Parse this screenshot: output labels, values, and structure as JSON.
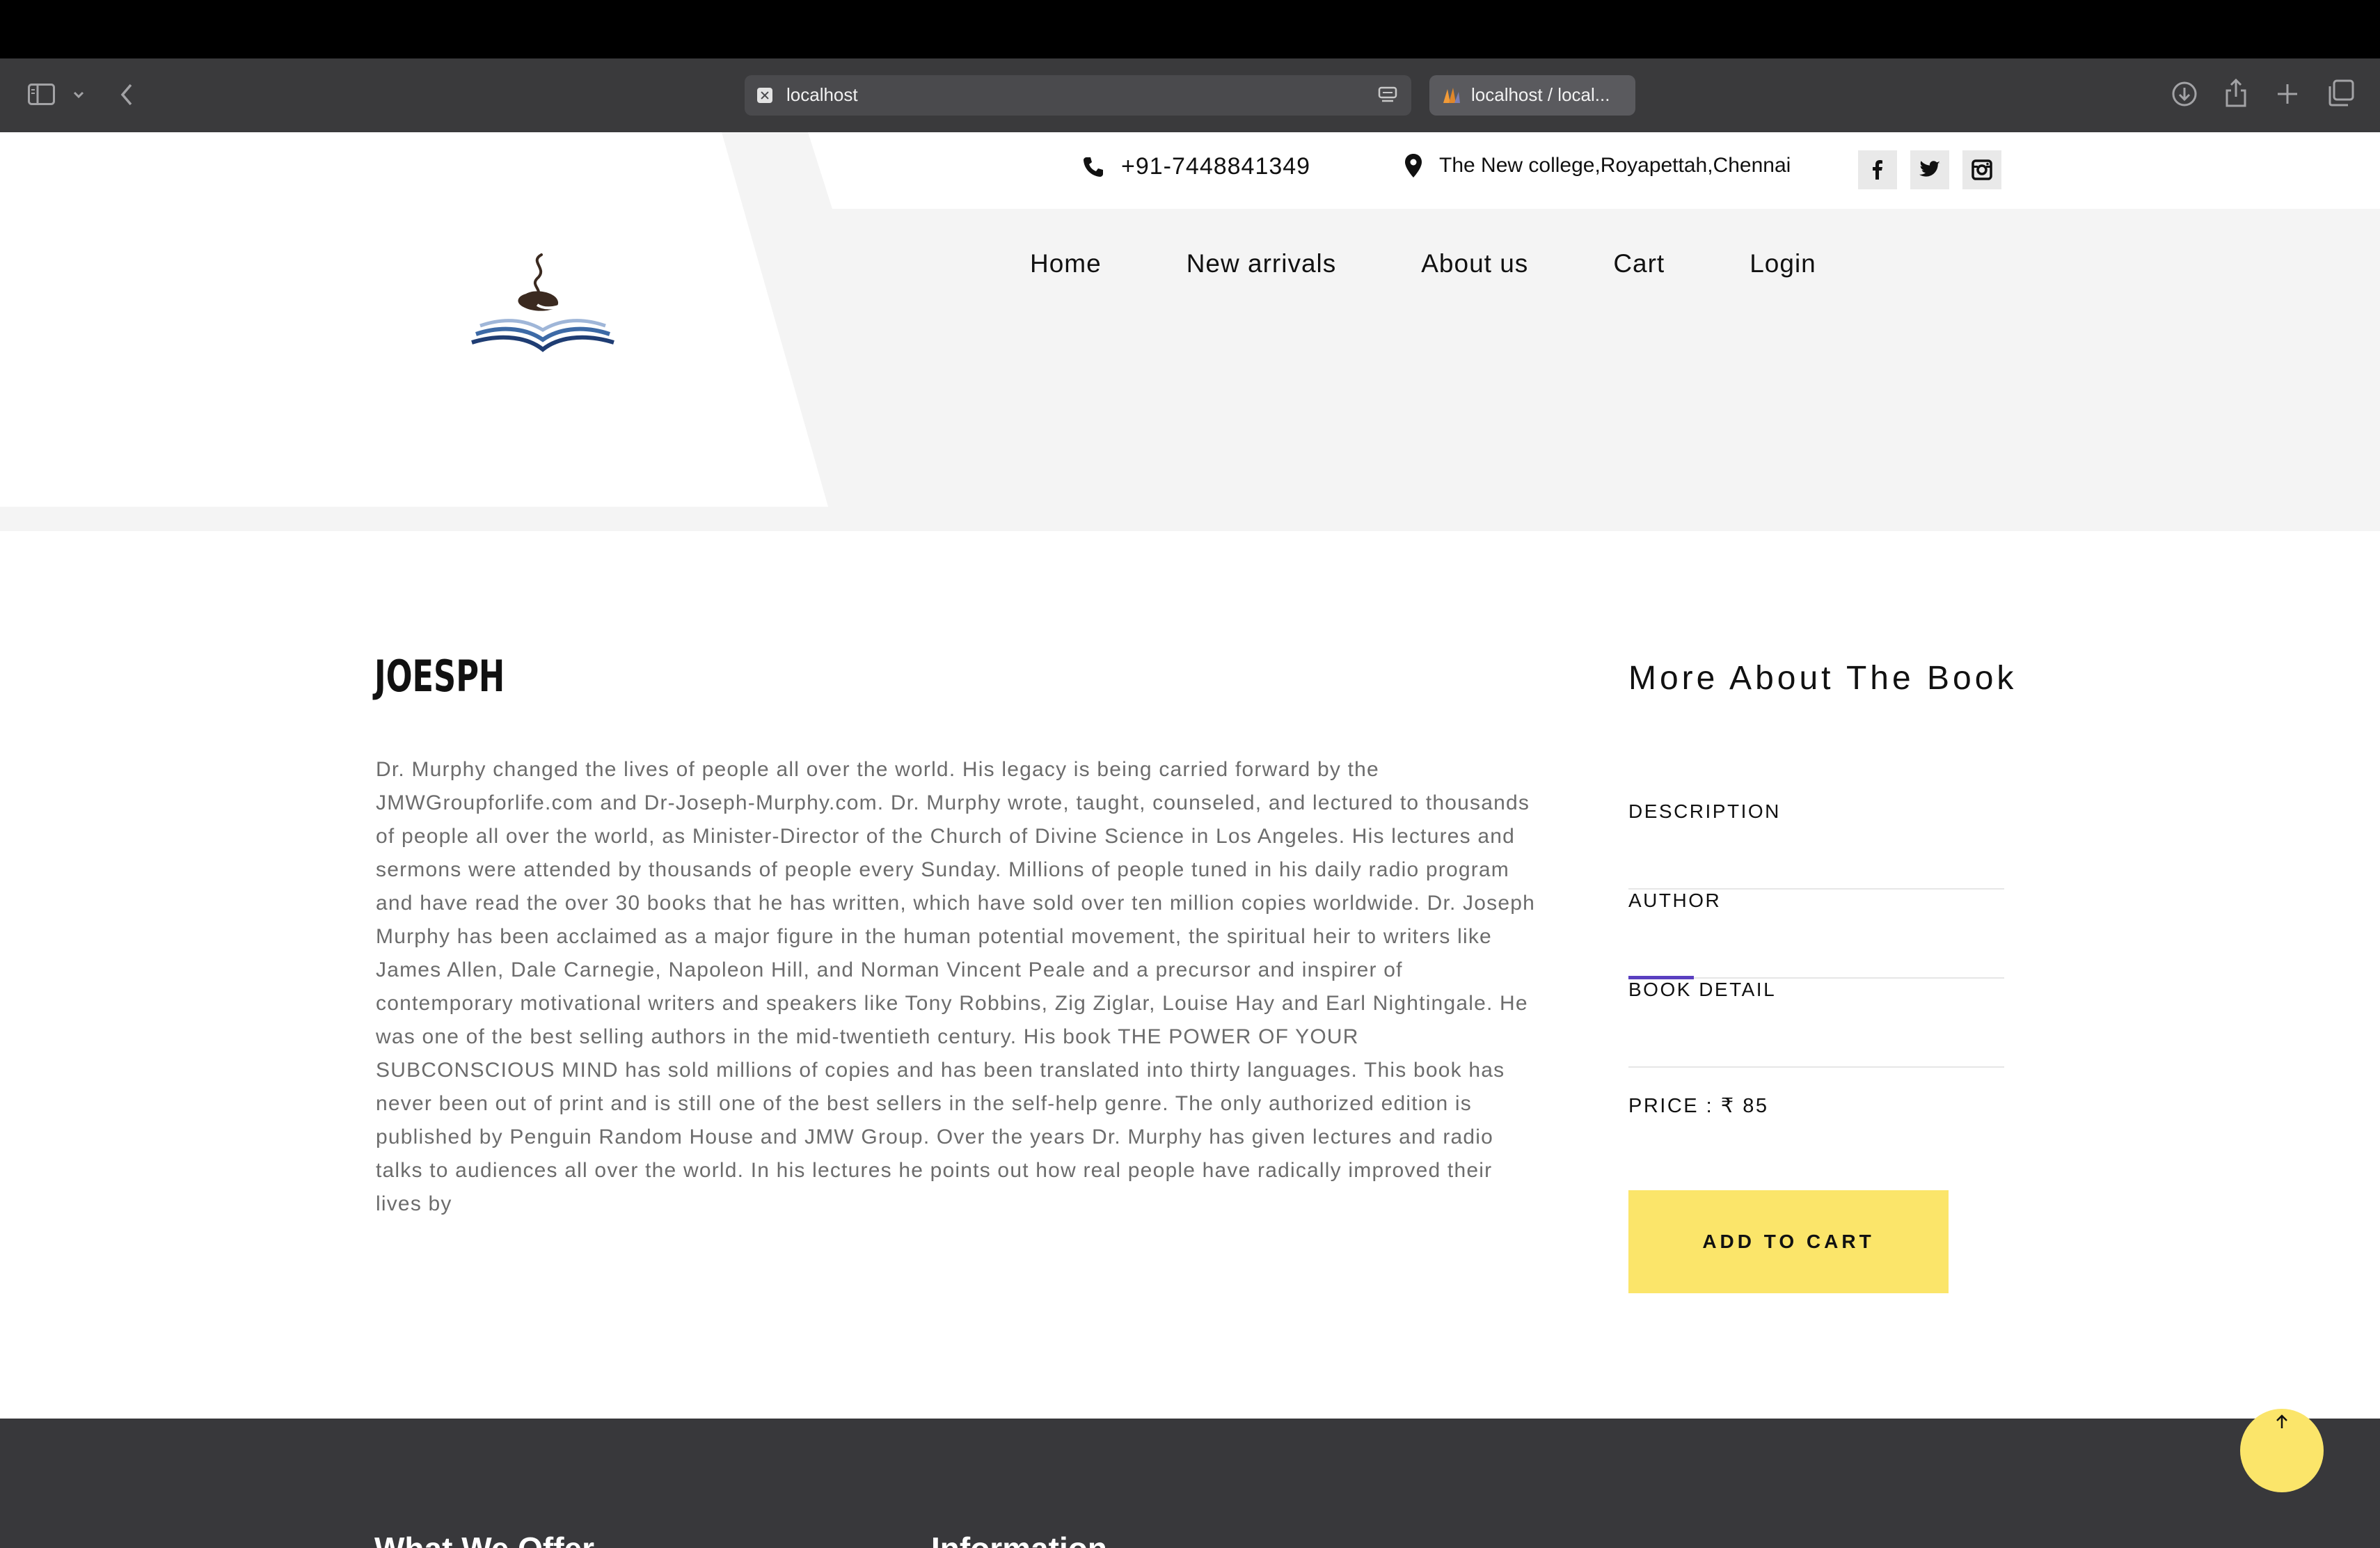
{
  "browser": {
    "url": "localhost",
    "tab_title": "localhost / local..."
  },
  "header": {
    "phone": "+91-7448841349",
    "address": "The New college,Royapettah,Chennai",
    "social": [
      "facebook-icon",
      "twitter-icon",
      "instagram-icon"
    ],
    "nav": [
      "Home",
      "New arrivals",
      "About us",
      "Cart",
      "Login"
    ]
  },
  "book": {
    "title": "JOESPH",
    "description": "Dr. Murphy changed the lives of people all over the world. His legacy is being carried forward by the JMWGroupforlife.com and Dr-Joseph-Murphy.com. Dr. Murphy wrote, taught, counseled, and lectured to thousands of people all over the world, as Minister-Director of the Church of Divine Science in Los Angeles. His lectures and sermons were attended by thousands of people every Sunday. Millions of people tuned in his daily radio program and have read the over 30 books that he has written, which have sold over ten million copies worldwide. Dr. Joseph Murphy has been acclaimed as a major figure in the human potential movement, the spiritual heir to writers like James Allen, Dale Carnegie, Napoleon Hill, and Norman Vincent Peale and a precursor and inspirer of contemporary motivational writers and speakers like Tony Robbins, Zig Ziglar, Louise Hay and Earl Nightingale. He was one of the best selling authors in the mid-twentieth century. His book THE POWER OF YOUR SUBCONSCIOUS MIND has sold millions of copies and has been translated into thirty languages. This book has never been out of print and is still one of the best sellers in the self-help genre. The only authorized edition is published by Penguin Random House and JMW Group. Over the years Dr. Murphy has given lectures and radio talks to audiences all over the world. In his lectures he points out how real people have radically improved their lives by"
  },
  "sidebar": {
    "title": "More About The Book",
    "tabs": [
      "DESCRIPTION",
      "AUTHOR",
      "BOOK DETAIL"
    ],
    "active_tab": "AUTHOR",
    "price": "PRICE : ₹ 85",
    "add_to_cart": "ADD TO CART"
  },
  "footer": {
    "headings": [
      "What We Offer",
      "Information"
    ]
  },
  "colors": {
    "accent_yellow": "#fbe56a",
    "active_tab": "#5a3fc0",
    "footer_bg": "#38383b",
    "header_bg": "#f4f4f4"
  }
}
